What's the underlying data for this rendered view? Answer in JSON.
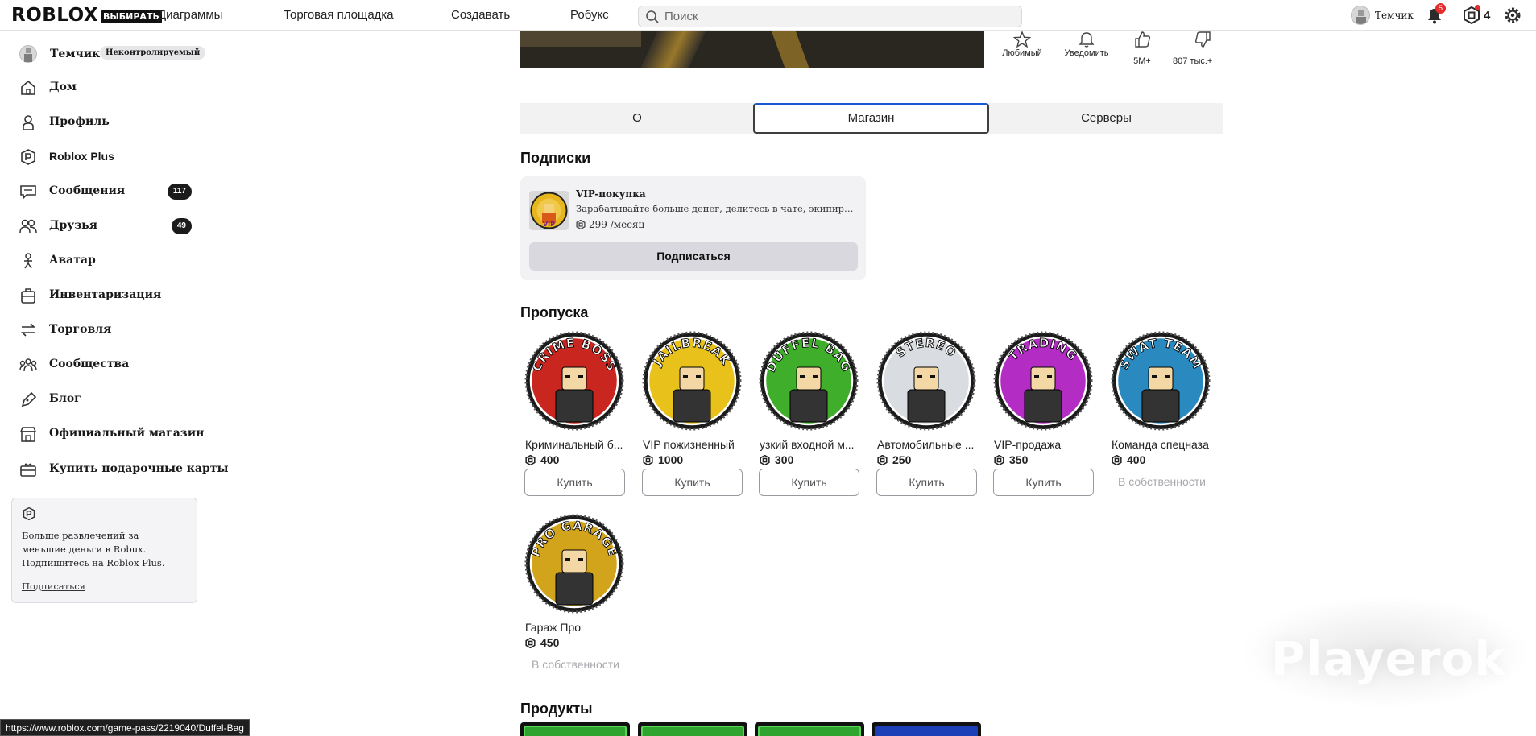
{
  "topbar": {
    "logo": "ROBLOX",
    "logo_badge": "ВЫБИРАТЬ",
    "nav": [
      "Диаграммы",
      "Торговая площадка",
      "Создавать",
      "Робукс"
    ],
    "search_placeholder": "Поиск",
    "username": "Темчик",
    "notifications_count": "5",
    "robux_count": "4"
  },
  "sidebar": {
    "username": "Темчик",
    "user_tag": "Неконтролируемый",
    "items": [
      {
        "label": "Дом",
        "icon": "home-icon"
      },
      {
        "label": "Профиль",
        "icon": "profile-icon"
      },
      {
        "label": "Roblox Plus",
        "icon": "roblox-plus-icon"
      },
      {
        "label": "Сообщения",
        "icon": "messages-icon",
        "count": "117"
      },
      {
        "label": "Друзья",
        "icon": "friends-icon",
        "count": "49"
      },
      {
        "label": "Аватар",
        "icon": "avatar-icon"
      },
      {
        "label": "Инвентаризация",
        "icon": "inventory-icon"
      },
      {
        "label": "Торговля",
        "icon": "trade-icon"
      },
      {
        "label": "Сообщества",
        "icon": "communities-icon"
      },
      {
        "label": "Блог",
        "icon": "blog-icon"
      },
      {
        "label": "Официальный магазин",
        "icon": "store-icon"
      },
      {
        "label": "Купить подарочные карты",
        "icon": "gift-card-icon"
      }
    ],
    "promo": {
      "text": "Больше развлечений за меньшие деньги в Robux. Подпишитесь на Roblox Plus.",
      "link": "Подписаться"
    }
  },
  "game_actions": {
    "favorite": "Любимый",
    "notify": "Уведомить",
    "likes": "5M+",
    "dislikes": "807 тыс.+"
  },
  "tabs": [
    "О",
    "Магазин",
    "Серверы"
  ],
  "active_tab": "Магазин",
  "subscriptions": {
    "heading": "Подписки",
    "item": {
      "title": "VIP-покупка",
      "description": "Зарабатывайте больше денег, делитесь в чате, экипируйте хро...",
      "price": "299",
      "period": "/месяц",
      "button": "Подписаться"
    }
  },
  "passes": {
    "heading": "Пропуска",
    "items": [
      {
        "name": "Криминальный б...",
        "price": "400",
        "action": "Купить",
        "badge_text": "CRIME BOSS",
        "color": "#c8261e"
      },
      {
        "name": "VIP пожизненный",
        "price": "1000",
        "action": "Купить",
        "badge_text": "JAILBREAK",
        "color": "#e8c21a"
      },
      {
        "name": "узкий входной м...",
        "price": "300",
        "action": "Купить",
        "badge_text": "DUFFEL BAG",
        "color": "#3fae2a"
      },
      {
        "name": "Автомобильные ...",
        "price": "250",
        "action": "Купить",
        "badge_text": "STEREO",
        "color": "#d9dce0"
      },
      {
        "name": "VIP-продажа",
        "price": "350",
        "action": "Купить",
        "badge_text": "TRADING",
        "color": "#b32cc4"
      },
      {
        "name": "Команда спецназа",
        "price": "400",
        "owned": "В собственности",
        "badge_text": "SWAT TEAM",
        "color": "#2a8ac0"
      },
      {
        "name": "Гараж Про",
        "price": "450",
        "owned": "В собственности",
        "badge_text": "PRO GARAGE",
        "color": "#d2a41c"
      }
    ]
  },
  "products": {
    "heading": "Продукты"
  },
  "status_bar_url": "https://www.roblox.com/game-pass/2219040/Duffel-Bag",
  "watermark": "Playerok"
}
